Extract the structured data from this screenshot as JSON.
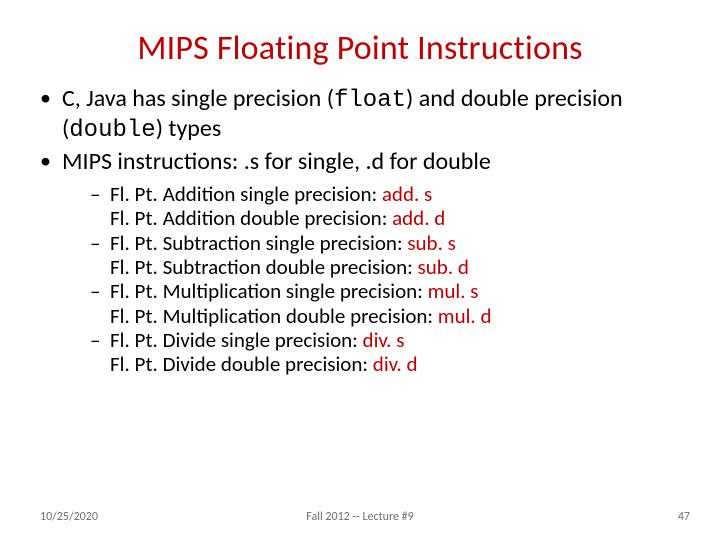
{
  "title": "MIPS Floating Point Instructions",
  "bullets": {
    "b1": {
      "t1": "C, Java has single precision (",
      "code1": "float",
      "t2": ") and double precision (",
      "code2": "double",
      "t3": ") types"
    },
    "b2": "MIPS instructions: .s for single, .d for double"
  },
  "sub": {
    "add": {
      "l1a": "Fl. Pt. Addition single precision: ",
      "l1b": "add. s",
      "l2a": "Fl. Pt. Addition double precision: ",
      "l2b": "add. d"
    },
    "sub_": {
      "l1a": "Fl. Pt. Subtraction single precision: ",
      "l1b": "sub. s",
      "l2a": "Fl. Pt. Subtraction double precision: ",
      "l2b": "sub. d"
    },
    "mul": {
      "l1a": "Fl. Pt. Multiplication single precision: ",
      "l1b": "mul. s",
      "l2a": "Fl. Pt. Multiplication double precision: ",
      "l2b": "mul. d"
    },
    "div": {
      "l1a": "Fl. Pt. Divide single precision: ",
      "l1b": "div. s",
      "l2a": "Fl. Pt. Divide double precision: ",
      "l2b": "div. d"
    }
  },
  "footer": {
    "date": "10/25/2020",
    "center": "Fall 2012 -- Lecture #9",
    "page": "47"
  }
}
